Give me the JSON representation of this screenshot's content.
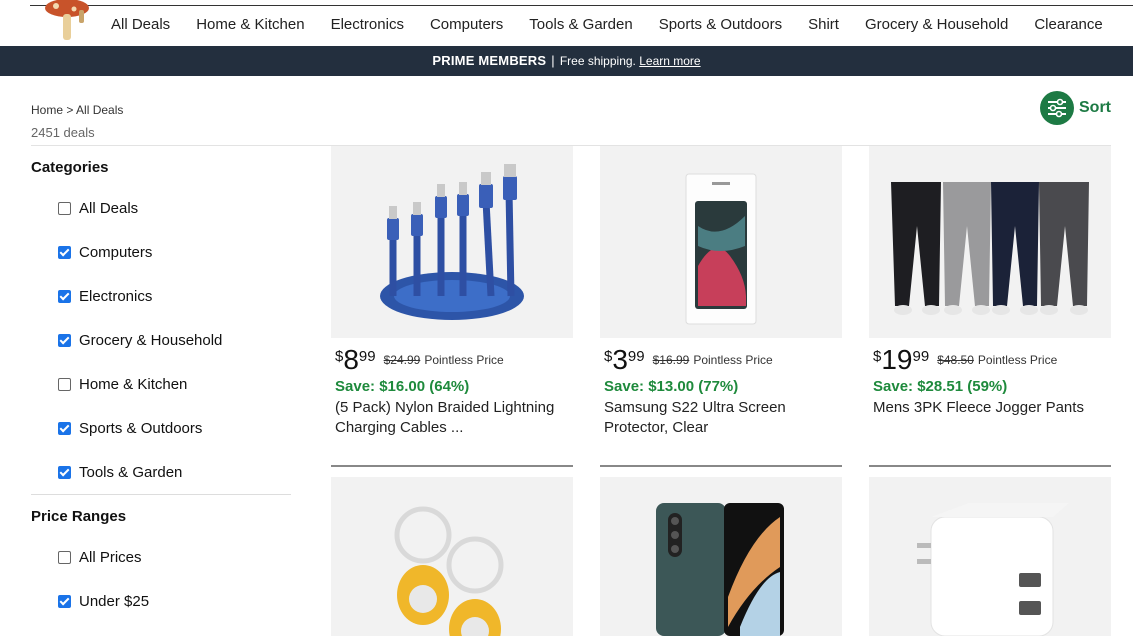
{
  "nav": {
    "items": [
      "All Deals",
      "Home & Kitchen",
      "Electronics",
      "Computers",
      "Tools & Garden",
      "Sports & Outdoors",
      "Shirt",
      "Grocery & Household",
      "Clearance"
    ]
  },
  "banner": {
    "title": "PRIME MEMBERS",
    "separator": "|",
    "text": "Free shipping.",
    "link": "Learn more"
  },
  "breadcrumb": "Home > All Deals",
  "deal_count": "2451 deals",
  "sort_label": "Sort",
  "sidebar": {
    "categories_title": "Categories",
    "categories": [
      {
        "label": "All Deals",
        "checked": false
      },
      {
        "label": "Computers",
        "checked": true
      },
      {
        "label": "Electronics",
        "checked": true
      },
      {
        "label": "Grocery & Household",
        "checked": true
      },
      {
        "label": "Home & Kitchen",
        "checked": false
      },
      {
        "label": "Sports & Outdoors",
        "checked": true
      },
      {
        "label": "Tools & Garden",
        "checked": true
      }
    ],
    "price_title": "Price Ranges",
    "prices": [
      {
        "label": "All Prices",
        "checked": false
      },
      {
        "label": "Under $25",
        "checked": true
      }
    ]
  },
  "products": [
    {
      "symbol": "$",
      "dollars": "8",
      "cents": "99",
      "was": "$24.99",
      "tag": "Pointless Price",
      "save": "Save: $16.00 (64%)",
      "title": "(5 Pack) Nylon Braided Lightning Charging Cables ...",
      "image": "charging-cables"
    },
    {
      "symbol": "$",
      "dollars": "3",
      "cents": "99",
      "was": "$16.99",
      "tag": "Pointless Price",
      "save": "Save: $13.00 (77%)",
      "title": "Samsung S22 Ultra Screen Protector, Clear",
      "image": "screen-protector"
    },
    {
      "symbol": "$",
      "dollars": "19",
      "cents": "99",
      "was": "$48.50",
      "tag": "Pointless Price",
      "save": "Save: $28.51 (59%)",
      "title": "Mens 3PK Fleece Jogger Pants",
      "image": "jogger-pants"
    },
    {
      "image": "airtag-keyrings"
    },
    {
      "image": "foldable-phone"
    },
    {
      "image": "usb-wall-charger"
    }
  ],
  "colors": {
    "banner_bg": "#232f3e",
    "save_green": "#1e8a3c",
    "sort_green": "#1d7a44",
    "checkbox_blue": "#1a73e8"
  }
}
